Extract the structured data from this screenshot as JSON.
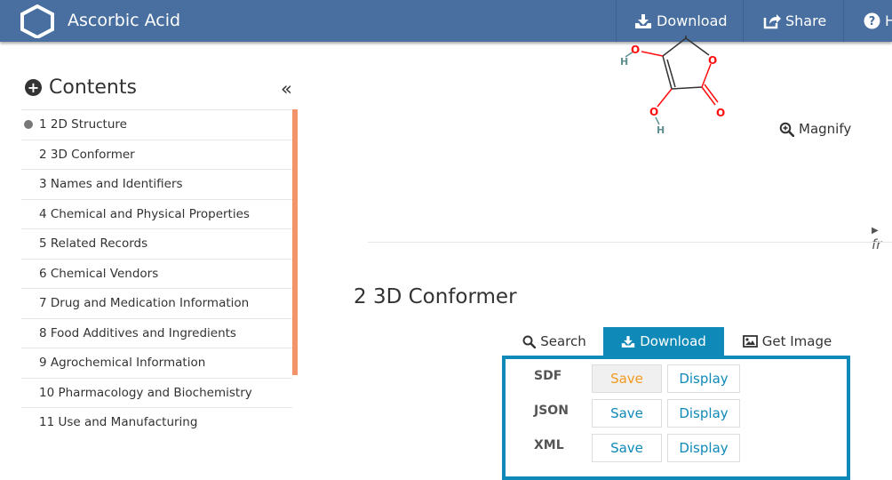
{
  "header": {
    "title": "Ascorbic Acid",
    "download_label": "Download",
    "share_label": "Share",
    "help_label": "H",
    "icons": [
      "hexagon-logo-icon",
      "download-icon",
      "share-icon",
      "help-icon"
    ]
  },
  "sidebar": {
    "title": "Contents",
    "collapse_glyph": "«",
    "items": [
      {
        "label": "1 2D Structure",
        "active": true
      },
      {
        "label": "2 3D Conformer"
      },
      {
        "label": "3 Names and Identifiers"
      },
      {
        "label": "4 Chemical and Physical Properties"
      },
      {
        "label": "5 Related Records"
      },
      {
        "label": "6 Chemical Vendors"
      },
      {
        "label": "7 Drug and Medication Information"
      },
      {
        "label": "8 Food Additives and Ingredients"
      },
      {
        "label": "9 Agrochemical Information"
      },
      {
        "label": "10 Pharmacology and Biochemistry"
      },
      {
        "label": "11 Use and Manufacturing"
      }
    ]
  },
  "structure": {
    "atoms": [
      "H",
      "O",
      "O",
      "O",
      "O",
      "H"
    ],
    "magnify_label": "Magnify",
    "source_caret": "fr"
  },
  "conformer": {
    "section_title": "2  3D Conformer",
    "tabs": {
      "search": "Search",
      "download": "Download",
      "image": "Get Image"
    },
    "formats": [
      {
        "name": "SDF",
        "save": "Save",
        "display": "Display"
      },
      {
        "name": "JSON",
        "save": "Save",
        "display": "Display"
      },
      {
        "name": "XML",
        "save": "Save",
        "display": "Display"
      }
    ]
  },
  "colors": {
    "header": "#486fa0",
    "accent": "#0e89b8",
    "scroll": "#f2936a",
    "oxygen": "#ff0d0d",
    "hydrogen": "#5f8f8f",
    "hover_text": "#f29a1f"
  }
}
